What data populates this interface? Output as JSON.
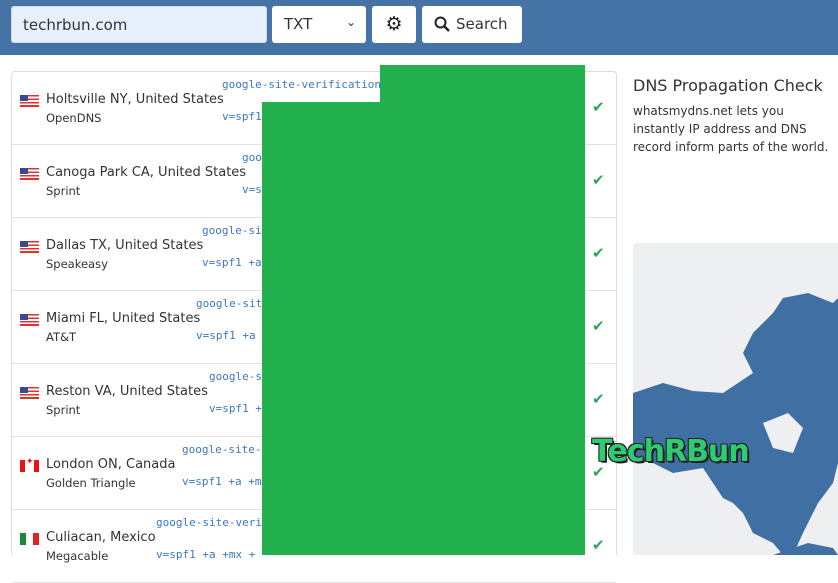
{
  "search": {
    "domain": "techrbun.com",
    "record_type": "TXT",
    "settings_icon": "gear-icon",
    "search_label": "Search",
    "search_icon": "search-icon"
  },
  "results": [
    {
      "location": "Holtsville NY, United States",
      "provider": "OpenDNS",
      "flag": "us",
      "record1": "google-site-verification",
      "record2": "v=spf1",
      "status": "check-icon"
    },
    {
      "location": "Canoga Park CA, United States",
      "provider": "Sprint",
      "flag": "us",
      "record1": "goo",
      "record2": "v=s",
      "status": "check-icon"
    },
    {
      "location": "Dallas TX, United States",
      "provider": "Speakeasy",
      "flag": "us",
      "record1": "google-si",
      "record2": "v=spf1 +a",
      "status": "check-icon"
    },
    {
      "location": "Miami FL, United States",
      "provider": "AT&T",
      "flag": "us",
      "record1": "google-site",
      "record2": "v=spf1 +a",
      "status": "check-icon"
    },
    {
      "location": "Reston VA, United States",
      "provider": "Sprint",
      "flag": "us",
      "record1": "google-s",
      "record2": "v=spf1 +",
      "status": "check-icon"
    },
    {
      "location": "London ON, Canada",
      "provider": "Golden Triangle",
      "flag": "ca",
      "record1": "google-site-",
      "record2": "v=spf1 +a +m",
      "status": "check-icon"
    },
    {
      "location": "Culiacan, Mexico",
      "provider": "Megacable",
      "flag": "mx",
      "record1": "google-site-veri",
      "record2": "v=spf1 +a +mx +",
      "status": "check-icon"
    }
  ],
  "info": {
    "title": "DNS Propagation Check",
    "description": "whatsmydns.net lets you instantly IP address and DNS record inform parts of the world."
  },
  "watermark": "TechRBun",
  "colors": {
    "header": "#4673a6",
    "check": "#2ea35a",
    "link": "#3a78c4",
    "overlay": "#22b14c",
    "map_land": "#3f6fa3"
  }
}
